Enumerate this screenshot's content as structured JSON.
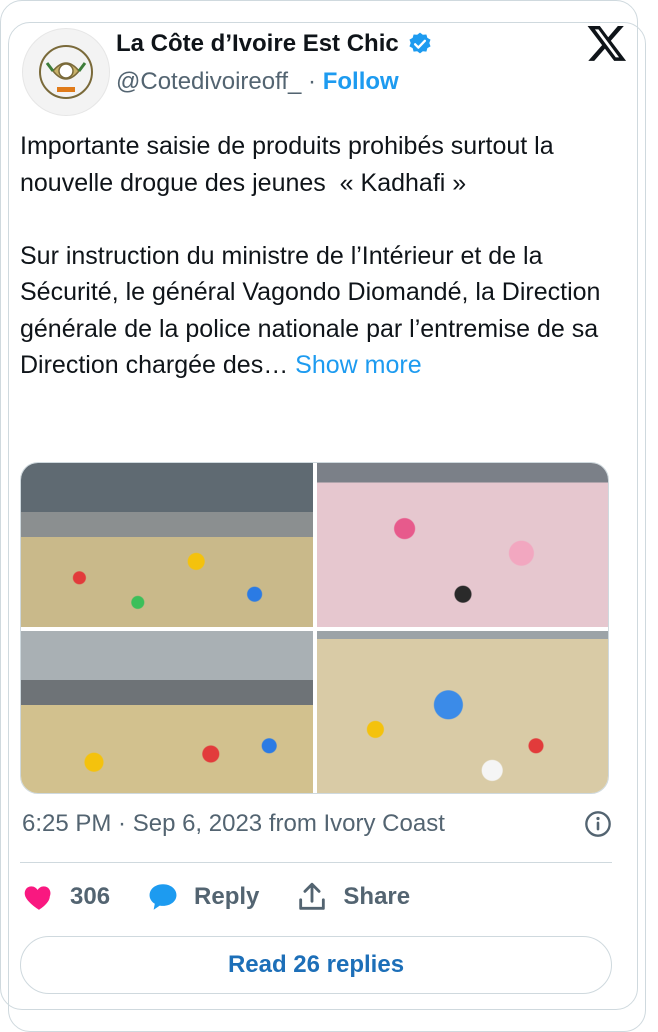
{
  "author": {
    "name": "La Côte d’Ivoire Est Chic",
    "handle": "@Cotedivoireoff_",
    "separator": "·",
    "follow_label": "Follow"
  },
  "tweet": {
    "text_para1": "Importante saisie de produits prohibés surtout la nouvelle drogue des jeunes  « Kadhafi »",
    "text_para2": "Sur instruction du ministre de l’Intérieur et de la Sécurité, le général Vagondo Diomandé, la Direction générale de la police nationale par l’entremise de sa Direction chargée des…",
    "show_more_label": "Show more",
    "timestamp": "6:25 PM · Sep 6, 2023 from Ivory Coast"
  },
  "icons": {
    "verified": "verified-badge-icon",
    "x_logo": "x-logo-icon",
    "info": "info-icon",
    "like": "heart-icon",
    "reply": "speech-bubble-icon",
    "share": "share-upload-icon"
  },
  "actions": {
    "likes_count": "306",
    "reply_label": "Reply",
    "share_label": "Share"
  },
  "read_replies_label": "Read 26 replies",
  "colors": {
    "accent": "#1d9bf0",
    "like": "#f91880",
    "muted": "#536471",
    "border": "#cfd9de"
  }
}
